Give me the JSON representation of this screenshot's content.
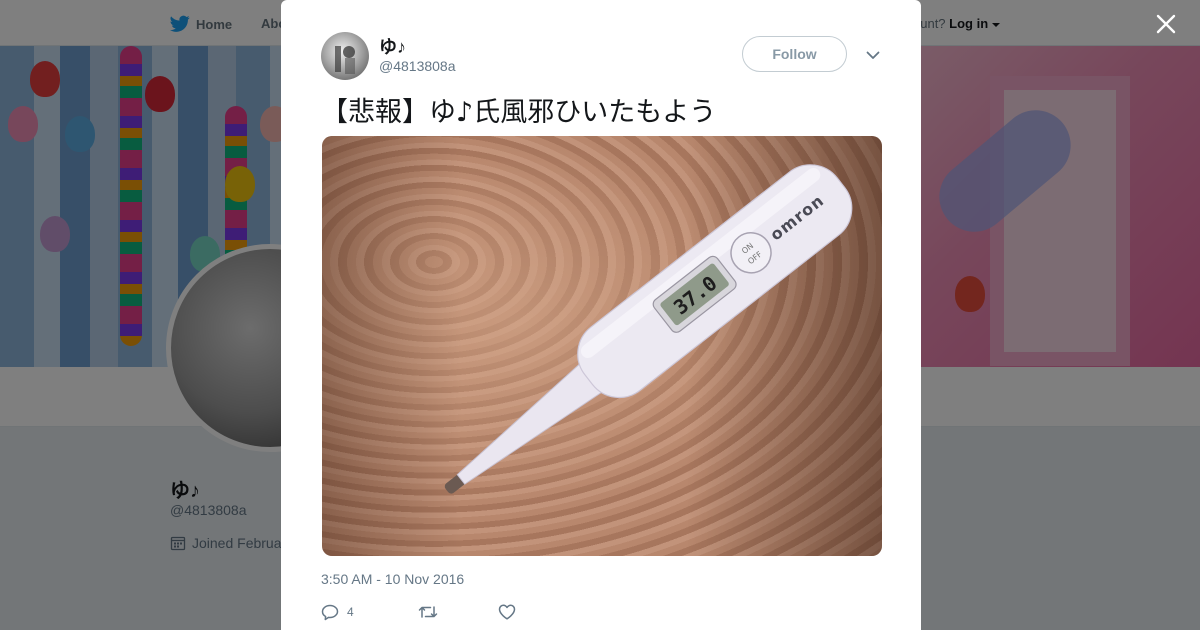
{
  "background_page": {
    "nav": {
      "home_label": "Home",
      "about_label": "Abo",
      "account_prompt": "ccount?",
      "login_label": "Log in"
    },
    "profile": {
      "name": "ゆ♪",
      "handle": "@4813808a",
      "joined_text": "Joined Februa"
    }
  },
  "tweet": {
    "author_name": "ゆ♪",
    "author_handle": "@4813808a",
    "follow_label": "Follow",
    "text": "【悲報】ゆ♪氏風邪ひいたもよう",
    "photo": {
      "brand_text": "omron",
      "power_button_text_1": "ON",
      "power_button_text_2": "OFF",
      "display_reading": "37.0"
    },
    "timestamp": "3:50 AM - 10 Nov 2016",
    "actions": {
      "reply_count": "4"
    }
  },
  "colors": {
    "twitter_blue": "#1da1f2",
    "text_primary": "#14171a",
    "text_secondary": "#657786",
    "overlay": "rgba(0,0,0,0.5)"
  },
  "icons": [
    "twitter-bird-icon",
    "caret-down-icon",
    "close-icon",
    "chevron-down-icon",
    "calendar-icon",
    "reply-icon",
    "retweet-icon",
    "heart-icon"
  ]
}
